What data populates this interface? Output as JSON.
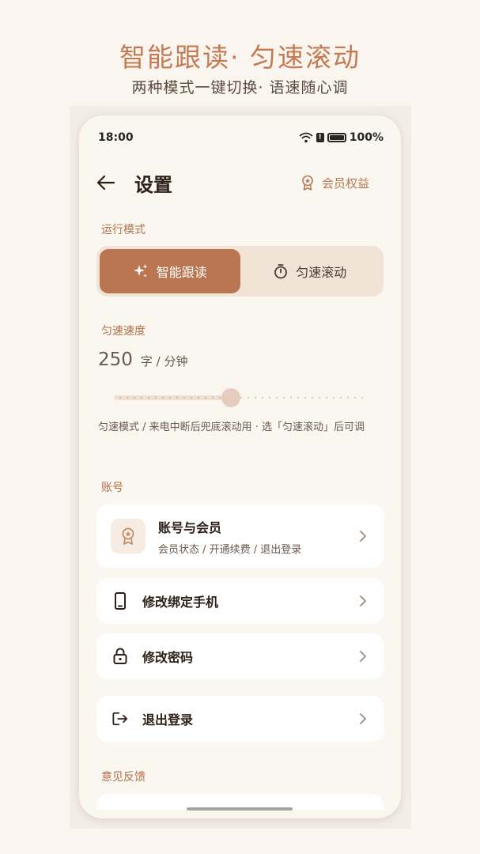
{
  "promo": {
    "headline": "智能跟读·  匀速滚动",
    "subline": "两种模式一键切换·  语速随心调"
  },
  "status_bar": {
    "time": "18:00",
    "battery": "100%"
  },
  "nav": {
    "title": "设置",
    "member_link": "会员权益"
  },
  "run_mode": {
    "label": "运行模式",
    "options": [
      {
        "label": "智能跟读",
        "icon": "sparkle-icon",
        "selected": true
      },
      {
        "label": "匀速滚动",
        "icon": "timer-icon",
        "selected": false
      }
    ]
  },
  "speed": {
    "label": "匀速速度",
    "value": "250",
    "unit": "字 / 分钟",
    "slider_fraction": 0.46,
    "hint": "匀速模式 / 来电中断后兜底滚动用 · 选「匀速滚动」后可调"
  },
  "account": {
    "label": "账号",
    "member_card": {
      "title": "账号与会员",
      "subtitle": "会员状态 / 开通续费 / 退出登录",
      "icon": "member-badge-icon"
    },
    "rows": [
      {
        "label": "修改绑定手机",
        "icon": "phone-icon"
      },
      {
        "label": "修改密码",
        "icon": "lock-icon"
      },
      {
        "label": "退出登录",
        "icon": "logout-icon"
      }
    ]
  },
  "feedback": {
    "label": "意见反馈"
  },
  "colors": {
    "accent": "#b97651",
    "accent_text": "#c57a52",
    "background": "#faf6f0",
    "segment_bg": "#f1e4d6"
  }
}
